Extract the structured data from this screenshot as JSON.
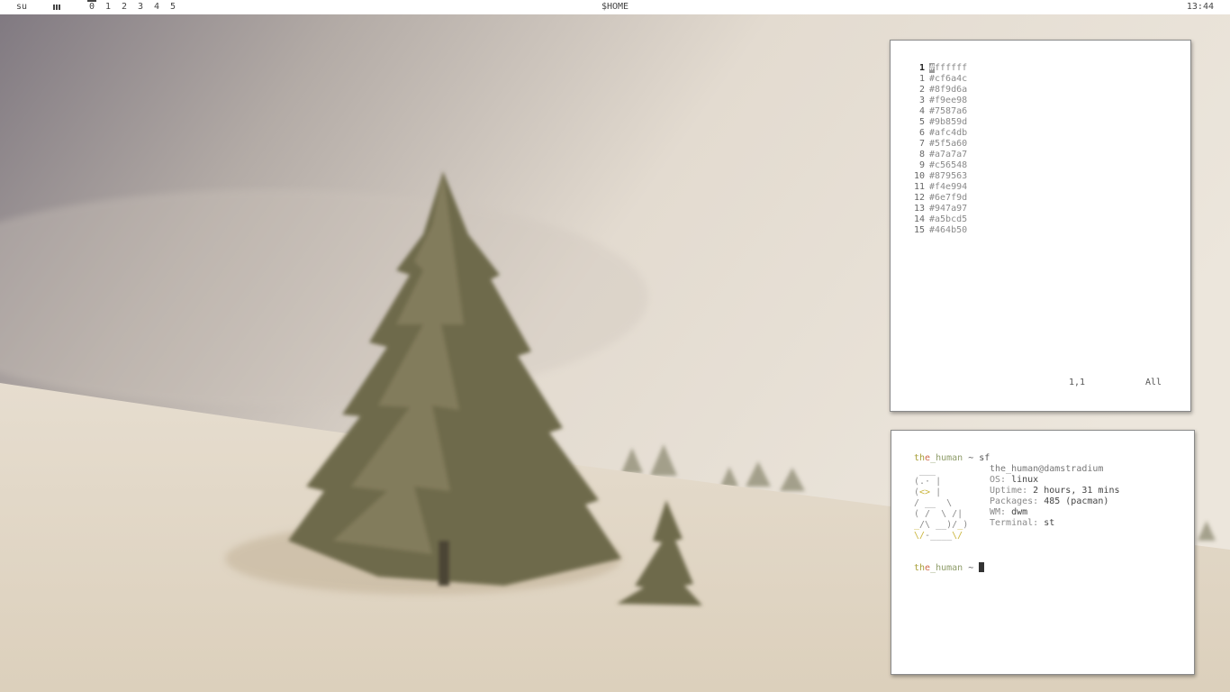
{
  "topbar": {
    "user": "su",
    "tags": [
      "0",
      "1",
      "2",
      "3",
      "4",
      "5"
    ],
    "active_tag": "0",
    "title": "$HOME",
    "clock": "13:44"
  },
  "vim": {
    "current_line_number": "1",
    "current_line_first_char": "#",
    "current_line_rest": "ffffff",
    "lines": [
      {
        "num": "1",
        "text": "#cf6a4c"
      },
      {
        "num": "2",
        "text": "#8f9d6a"
      },
      {
        "num": "3",
        "text": "#f9ee98"
      },
      {
        "num": "4",
        "text": "#7587a6"
      },
      {
        "num": "5",
        "text": "#9b859d"
      },
      {
        "num": "6",
        "text": "#afc4db"
      },
      {
        "num": "7",
        "text": "#5f5a60"
      },
      {
        "num": "8",
        "text": "#a7a7a7"
      },
      {
        "num": "9",
        "text": "#c56548"
      },
      {
        "num": "10",
        "text": "#879563"
      },
      {
        "num": "11",
        "text": "#f4e994"
      },
      {
        "num": "12",
        "text": "#6e7f9d"
      },
      {
        "num": "13",
        "text": "#947a97"
      },
      {
        "num": "14",
        "text": "#a5bcd5"
      },
      {
        "num": "15",
        "text": "#464b50"
      }
    ],
    "ruler": "1,1",
    "percent": "All"
  },
  "terminal": {
    "prompt_user_a": "th",
    "prompt_user_b": "e",
    "prompt_user_c": "_human",
    "prompt_tail": " ~ ",
    "command": "sf",
    "host": "the_human@damstradium",
    "info": [
      {
        "key": "OS:",
        "value": " linux"
      },
      {
        "key": "Uptime:",
        "value": " 2 hours, 31 mins"
      },
      {
        "key": "Packages:",
        "value": " 485 (pacman)"
      },
      {
        "key": "WM:",
        "value": " dwm"
      },
      {
        "key": "Terminal:",
        "value": " st"
      }
    ]
  },
  "colors": {
    "bar_bg": "#ffffff",
    "bar_fg": "#444444",
    "window_bg": "#ffffff",
    "prompt_accent_1": "#a8a03a",
    "prompt_accent_2": "#cf6a4c",
    "prompt_accent_3": "#8f9d6a"
  }
}
